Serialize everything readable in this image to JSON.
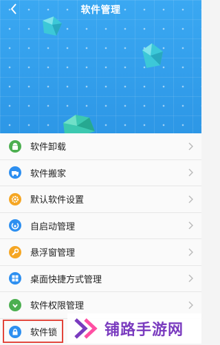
{
  "header": {
    "title": "软件管理"
  },
  "menu": [
    {
      "label": "软件卸载",
      "icon": "android-uninstall-icon",
      "color": "#4caf50"
    },
    {
      "label": "软件搬家",
      "icon": "move-icon",
      "color": "#2d8ff0"
    },
    {
      "label": "默认软件设置",
      "icon": "gear-icon",
      "color": "#f5a623"
    },
    {
      "label": "自启动管理",
      "icon": "autostart-icon",
      "color": "#2d8ff0"
    },
    {
      "label": "悬浮窗管理",
      "icon": "float-window-icon",
      "color": "#f5a623"
    },
    {
      "label": "桌面快捷方式管理",
      "icon": "shortcut-grid-icon",
      "color": "#2d8ff0"
    },
    {
      "label": "软件权限管理",
      "icon": "permission-icon",
      "color": "#4caf50"
    },
    {
      "label": "软件锁",
      "icon": "lock-icon",
      "color": "#2d8ff0"
    }
  ],
  "watermark": {
    "text": "铺路手游网"
  },
  "colors": {
    "header_bg": "#3aa6f0",
    "gem": "#3cc8d8",
    "highlight": "#e2453a",
    "watermark_text": "#7a3bbf"
  }
}
